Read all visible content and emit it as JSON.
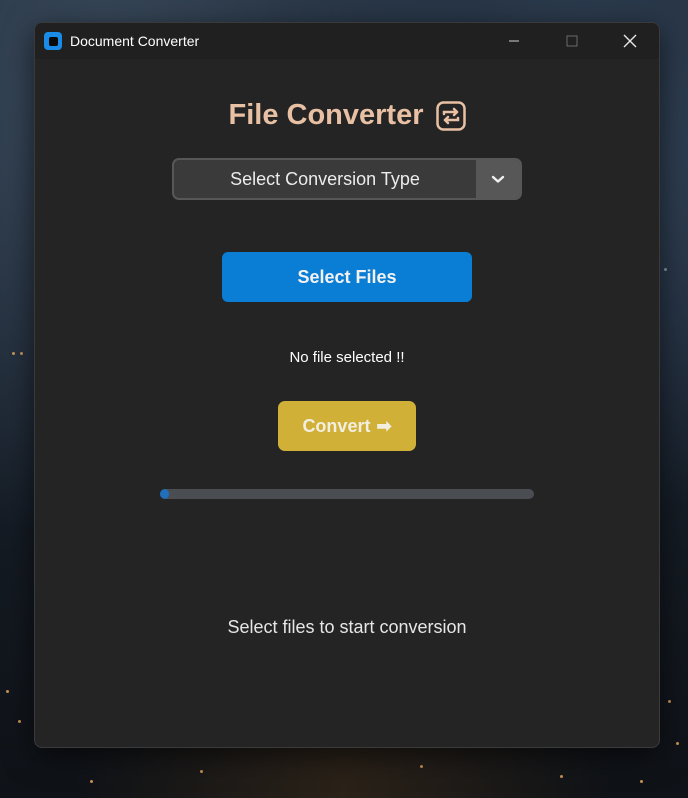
{
  "window": {
    "title": "Document Converter"
  },
  "app": {
    "heading": "File Converter",
    "heading_icon": "repeat-icon",
    "heading_color": "#e8c0a4"
  },
  "conversion_dropdown": {
    "selected": "Select Conversion Type"
  },
  "select_files_button": {
    "label": "Select Files",
    "color": "#0a7dd4"
  },
  "file_status": "No file selected !!",
  "convert_button": {
    "label": "Convert",
    "arrow": "➡",
    "color": "#d1b038"
  },
  "progress": {
    "value": 0.01,
    "color": "#1f6fbd"
  },
  "status_message": "Select files to start conversion"
}
